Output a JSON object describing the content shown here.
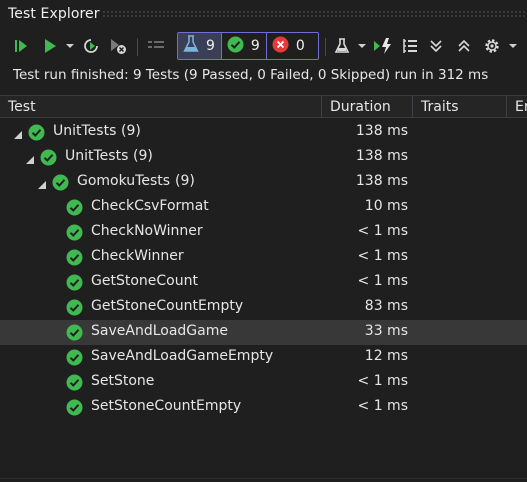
{
  "window": {
    "title": "Test Explorer"
  },
  "toolbar": {
    "run_all_icon": "run-all-icon",
    "run_icon": "run-icon",
    "repeat_icon": "repeat-last-run-icon",
    "cancel_icon": "cancel-run-icon",
    "playlist_icon": "playlist-icon",
    "counters": [
      {
        "icon": "flask-icon",
        "value": "9"
      },
      {
        "icon": "passed-icon",
        "value": "9"
      },
      {
        "icon": "failed-icon",
        "value": "0"
      }
    ],
    "right_icons": [
      "analyze-icon",
      "run-after-build-icon",
      "group-by-icon",
      "expand-all-icon",
      "collapse-all-icon",
      "settings-icon"
    ]
  },
  "status": {
    "text": "Test run finished: 9 Tests (9 Passed, 0 Failed, 0 Skipped) run in 312 ms"
  },
  "columns": [
    {
      "label": "Test"
    },
    {
      "label": "Duration"
    },
    {
      "label": "Traits"
    },
    {
      "label": "Er"
    }
  ],
  "rows": [
    {
      "name": "UnitTests",
      "count": "(9)",
      "duration": "138 ms",
      "level": 0,
      "expandable": true
    },
    {
      "name": "UnitTests",
      "count": "(9)",
      "duration": "138 ms",
      "level": 1,
      "expandable": true
    },
    {
      "name": "GomokuTests",
      "count": "(9)",
      "duration": "138 ms",
      "level": 2,
      "expandable": true
    },
    {
      "name": "CheckCsvFormat",
      "count": "",
      "duration": "10 ms",
      "level": 3,
      "expandable": false
    },
    {
      "name": "CheckNoWinner",
      "count": "",
      "duration": "< 1 ms",
      "level": 3,
      "expandable": false
    },
    {
      "name": "CheckWinner",
      "count": "",
      "duration": "< 1 ms",
      "level": 3,
      "expandable": false
    },
    {
      "name": "GetStoneCount",
      "count": "",
      "duration": "< 1 ms",
      "level": 3,
      "expandable": false
    },
    {
      "name": "GetStoneCountEmpty",
      "count": "",
      "duration": "83 ms",
      "level": 3,
      "expandable": false
    },
    {
      "name": "SaveAndLoadGame",
      "count": "",
      "duration": "33 ms",
      "level": 3,
      "expandable": false,
      "selected": true
    },
    {
      "name": "SaveAndLoadGameEmpty",
      "count": "",
      "duration": "12 ms",
      "level": 3,
      "expandable": false
    },
    {
      "name": "SetStone",
      "count": "",
      "duration": "< 1 ms",
      "level": 3,
      "expandable": false
    },
    {
      "name": "SetStoneCountEmpty",
      "count": "",
      "duration": "< 1 ms",
      "level": 3,
      "expandable": false
    }
  ],
  "colors": {
    "passed": "#3fb950",
    "accent": "#6f6fd6",
    "failed": "#e23b3b",
    "selected_row": "#383838"
  }
}
